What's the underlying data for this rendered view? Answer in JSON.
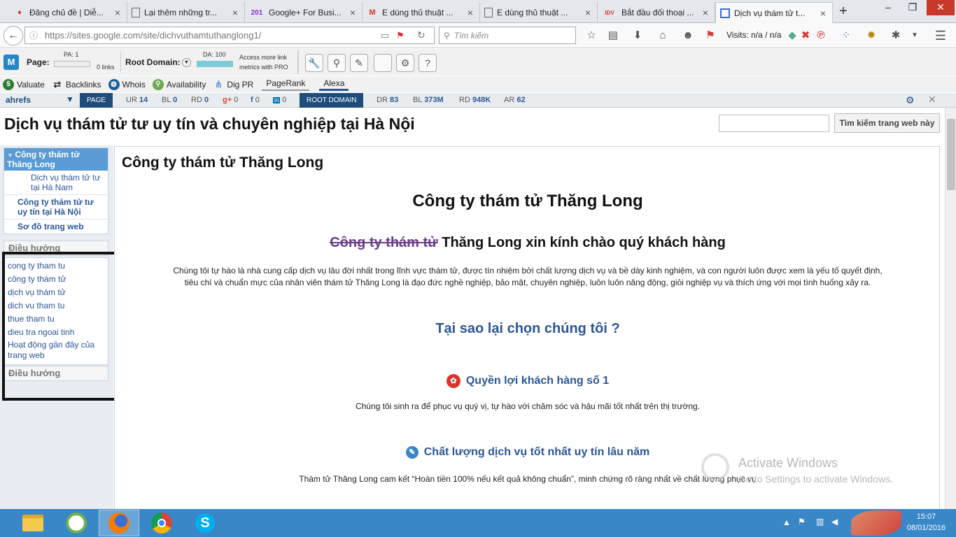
{
  "browser": {
    "tabs": [
      {
        "title": "Đăng chủ đề | Diễ...",
        "icon": "flame-icon",
        "color": "#d33"
      },
      {
        "title": "Lại thêm những tr...",
        "icon": "document-icon",
        "color": "#555"
      },
      {
        "title": "Google+ For Busi...",
        "icon": "201-logo",
        "label": "201",
        "color": "#8a2be2"
      },
      {
        "title": "E dùng thủ thuật ...",
        "icon": "gmail-icon",
        "label": "M",
        "color": "#d93025"
      },
      {
        "title": "E dùng thủ thuật ...",
        "icon": "document-icon",
        "color": "#555"
      },
      {
        "title": "Bắt đầu đối thoại ...",
        "icon": "idv-icon",
        "label": "IDV",
        "color": "#d33"
      },
      {
        "title": "Dịch vụ thám tử t...",
        "icon": "sites-icon",
        "color": "#3b6fd6"
      }
    ],
    "url": "https://sites.google.com/site/dichvuthamtuthanglong1/",
    "search_placeholder": "Tìm kiếm",
    "visits": "Visits: n/a / n/a"
  },
  "moz": {
    "page_label": "Page:",
    "pa": "PA: 1",
    "links": "0 links",
    "root_domain_label": "Root Domain:",
    "da": "DA: 100",
    "access_text_1": "Access more link",
    "access_text_2": "metrics with PRO"
  },
  "seoquake": {
    "items": [
      {
        "label": "Valuate",
        "icon": "dollar-icon",
        "color": "#2e7d32"
      },
      {
        "label": "Backlinks",
        "icon": "arrows-icon",
        "color": "#333"
      },
      {
        "label": "Whois",
        "icon": "globe-icon",
        "color": "#1b5e9a"
      },
      {
        "label": "Availability",
        "icon": "search-circle-icon",
        "color": "#6aa84f"
      },
      {
        "label": "Dig PR",
        "icon": "network-icon",
        "color": "#5b9bd5"
      }
    ],
    "tabs": [
      "PageRank",
      "Alexa"
    ]
  },
  "ahrefs": {
    "logo": "ahrefs",
    "page_flag": "PAGE",
    "ur": "14",
    "bl": "0",
    "rd": "0",
    "gplus": "0",
    "fb": "0",
    "li": "0",
    "root_flag": "ROOT DOMAIN",
    "dr": "83",
    "bl2": "373M",
    "rd2": "948K",
    "ar": "62",
    "labels": {
      "ur": "UR",
      "bl": "BL",
      "rd": "RD",
      "dr": "DR",
      "ar": "AR"
    }
  },
  "site": {
    "title": "Dịch vụ thám tử tư uy tín và chuyên nghiệp tại Hà Nội",
    "search_button": "Tìm kiếm trang web này",
    "sidebar": {
      "active": "Công ty thám tử Thăng Long",
      "sub_item": "Dịch vụ thám tử tư tại Hà Nam",
      "items": [
        "Công ty thám tử tư uy tín tại Hà Nội",
        "Sơ đồ trang web"
      ],
      "nav_heading": "Điều hướng",
      "links": [
        "cong ty tham tu",
        "công ty thám tử",
        "dịch vụ thám tử",
        "dich vu tham tu",
        "thue tham tu",
        "dieu tra ngoai tinh",
        "Hoạt động gần đây của trang web"
      ],
      "nav_heading_2": "Điều hướng"
    },
    "content": {
      "title": "Công ty thám tử Thăng Long",
      "h1": "Công ty thám tử Thăng Long",
      "greet_link": "Công ty thám tử",
      "greet_rest": " Thăng Long xin kính chào quý khách hàng",
      "intro_1": "Chúng tôi tự hào là nhà cung cấp dịch vụ lâu đời nhất trong lĩnh vực thám tử, được tín nhiệm bởi chất lượng dịch vụ và bề dày kinh nghiệm, và con người luôn được xem là yếu tố quyết định,",
      "intro_2": "tiêu chí và chuẩn mực của nhân viên thám tử Thăng Long là đạo đức nghề nghiệp, bảo mật, chuyên nghiệp, luôn luôn năng động, giỏi nghiệp vụ và thích ứng với mọi tình huống xảy ra.",
      "why": "Tại sao lại chọn chúng tôi ?",
      "benefit_title": "Quyền lợi khách hàng số 1",
      "benefit_text": "Chúng tôi sinh ra để phục vụ quý vị, tự hào với chăm sóc và hậu mãi tốt nhất trên thị trường.",
      "quality_title": "Chất lượng dịch vụ tốt nhất uy tín lâu năm",
      "quality_text": "Thám tử Thăng Long cam kết “Hoàn tiền 100% nếu kết quả không chuẩn”, minh chứng rõ ràng nhất về chất lượng phục vụ"
    }
  },
  "watermark": {
    "line1": "Activate Windows",
    "line2": "Go to Settings to activate Windows."
  },
  "taskbar": {
    "apps": [
      "file-explorer-icon",
      "orbit-icon",
      "firefox-icon",
      "chrome-icon",
      "skype-icon"
    ],
    "time": "15:07",
    "date": "08/01/2016"
  },
  "colors": {
    "link": "#2b5797",
    "accent": "#5b9bd5",
    "taskbar": "#3a87c8"
  }
}
